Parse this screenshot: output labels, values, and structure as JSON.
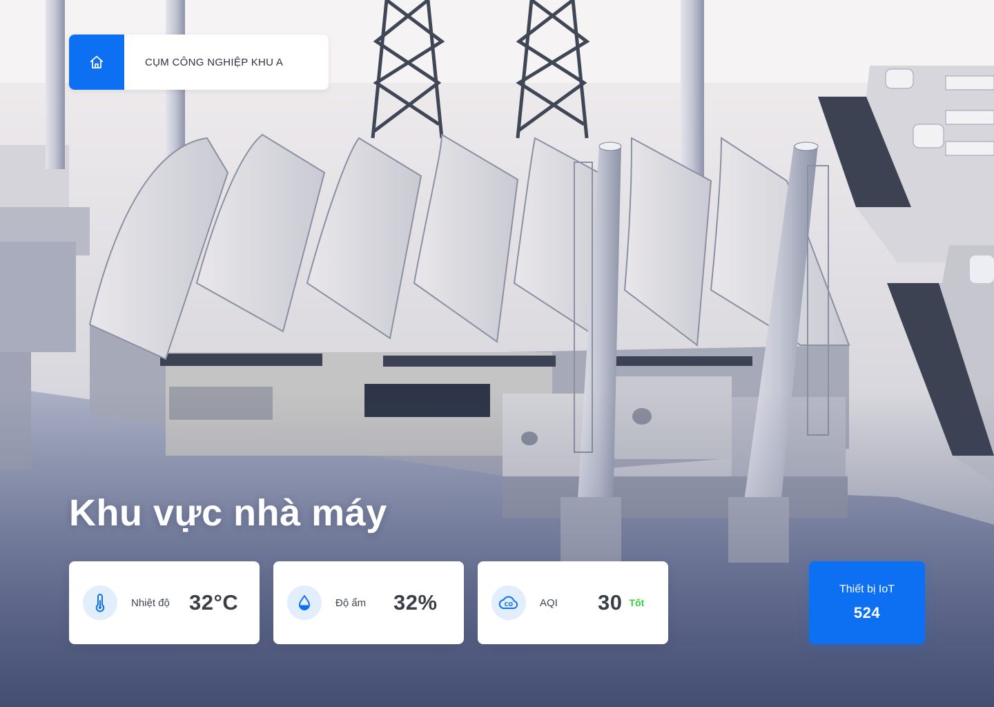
{
  "header": {
    "home_icon": "home-icon",
    "breadcrumb_label": "CỤM CÔNG NGHIỆP KHU A"
  },
  "page": {
    "title": "Khu vực nhà máy"
  },
  "metrics": [
    {
      "icon": "thermometer-icon",
      "label": "Nhiệt độ",
      "value": "32°C",
      "status": ""
    },
    {
      "icon": "water-drop-icon",
      "label": "Độ ẩm",
      "value": "32%",
      "status": ""
    },
    {
      "icon": "co2-cloud-icon",
      "label": "AQI",
      "value": "30",
      "status": "Tốt"
    }
  ],
  "iot": {
    "label": "Thiết bị IoT",
    "value": "524"
  },
  "colors": {
    "accent": "#0d6ff2",
    "good_status": "#2fcf3c",
    "icon_bg": "#e3eefc"
  }
}
